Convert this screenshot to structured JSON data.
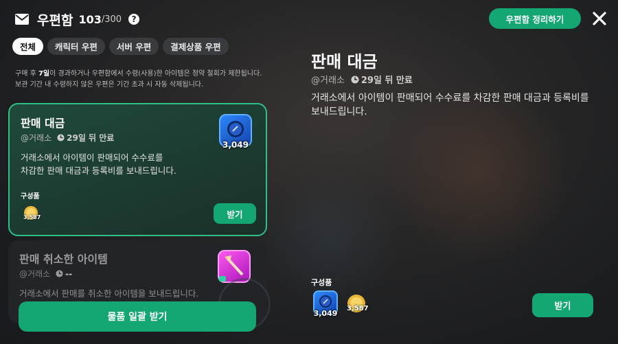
{
  "header": {
    "title": "우편함",
    "count": "103",
    "count_max": "/300",
    "help": "?",
    "organize_label": "우편함 정리하기"
  },
  "tabs": [
    {
      "label": "전체",
      "active": true
    },
    {
      "label": "캐릭터 우편",
      "active": false
    },
    {
      "label": "서버 우편",
      "active": false
    },
    {
      "label": "결제상품 우편",
      "active": false
    }
  ],
  "notice": {
    "line1_prefix": "구매 후 ",
    "line1_bold": "7일",
    "line1_suffix": "이 경과하거나 우편함에서 수령(사용)한 아이템은 청약 철회가 제한됩니다.",
    "line2": "보관 기간 내 수령하지 않은 우편은 기간 초과 시 자동 삭제됩니다."
  },
  "mails": [
    {
      "title": "판매 대금",
      "sender": "@거래소",
      "expiry": "29일 뒤 만료",
      "desc_line1": "거래소에서 아이템이 판매되어 수수료를",
      "desc_line2": "차감한 판매 대금과 등록비를 보내드립니다.",
      "component_label": "구성품",
      "coin_amount": "3,587",
      "item_amount": "3,049",
      "receive_label": "받기"
    },
    {
      "title": "판매 취소한 아이템",
      "sender": "@거래소",
      "expiry": "--",
      "desc_line1": "거래소에서 판매를 취소한 아이템을 보내드립니다."
    }
  ],
  "bulk_receive_label": "물품 일괄 받기",
  "detail": {
    "title": "판매 대금",
    "sender": "@거래소",
    "expiry": "29일 뒤 만료",
    "desc_line1": "거래소에서 아이템이 판매되어 수수료를 차감한 판매 대금과 등록비를",
    "desc_line2": "보내드립니다.",
    "component_label": "구성품",
    "item_amount": "3,049",
    "coin_amount": "3,587",
    "receive_label": "받기"
  },
  "colors": {
    "accent": "#14a673",
    "selected_border": "#2fbf88"
  }
}
